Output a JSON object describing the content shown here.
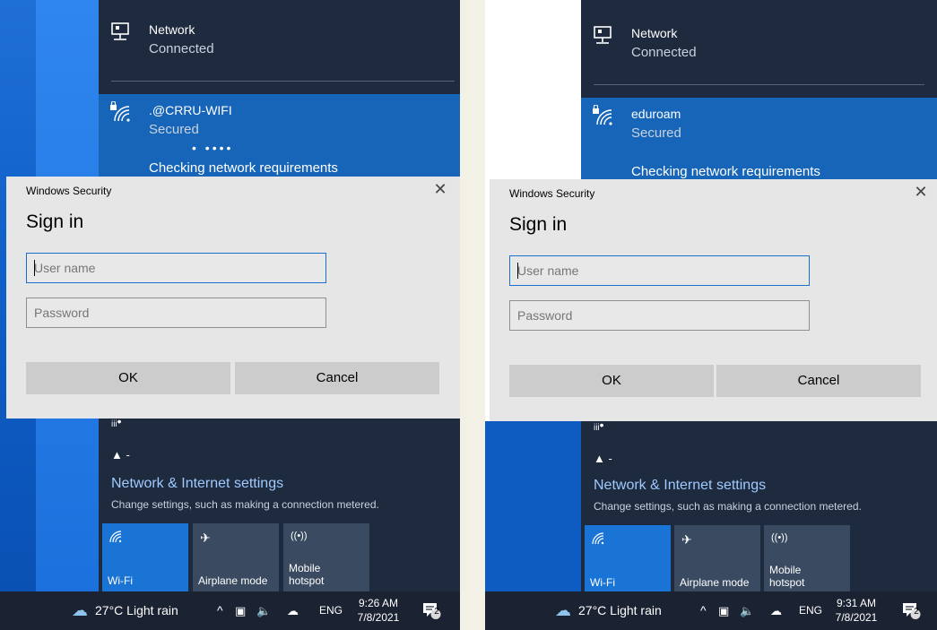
{
  "colors": {
    "flyout": "#1e2a3e",
    "selected": "#1665b8",
    "accent": "#1a74d6",
    "dialog": "#e6e6e6",
    "link": "#9fcaff"
  },
  "panels": [
    {
      "wired": {
        "name": "Network",
        "status": "Connected"
      },
      "wifi": {
        "name": ".@CRRU-WIFI",
        "status": "Secured",
        "progress": "• ••••",
        "message": "Checking network requirements"
      },
      "dialog": {
        "title": "Windows Security",
        "close": "✕",
        "heading": "Sign in",
        "username_placeholder": "User name",
        "password_placeholder": "Password",
        "ok": "OK",
        "cancel": "Cancel"
      },
      "settings": {
        "link": "Network & Internet settings",
        "description": "Change settings, such as making a connection metered."
      },
      "tiles": [
        {
          "label": "Wi-Fi",
          "icon": "wifi-icon"
        },
        {
          "label": "Airplane mode",
          "icon": "airplane-icon"
        },
        {
          "label": "Mobile hotspot",
          "icon": "hotspot-icon"
        }
      ],
      "taskbar": {
        "weather": "27°C  Light rain",
        "lang": "ENG",
        "time": "9:26 AM",
        "date": "7/8/2021",
        "notifications": "2"
      }
    },
    {
      "wired": {
        "name": "Network",
        "status": "Connected"
      },
      "wifi": {
        "name": "eduroam",
        "status": "Secured",
        "message": "Checking network requirements"
      },
      "dialog": {
        "title": "Windows Security",
        "close": "✕",
        "heading": "Sign in",
        "username_placeholder": "User name",
        "password_placeholder": "Password",
        "ok": "OK",
        "cancel": "Cancel"
      },
      "settings": {
        "link": "Network & Internet settings",
        "description": "Change settings, such as making a connection metered."
      },
      "tiles": [
        {
          "label": "Wi-Fi",
          "icon": "wifi-icon"
        },
        {
          "label": "Airplane mode",
          "icon": "airplane-icon"
        },
        {
          "label": "Mobile hotspot",
          "icon": "hotspot-icon"
        }
      ],
      "taskbar": {
        "weather": "27°C  Light rain",
        "lang": "ENG",
        "time": "9:31 AM",
        "date": "7/8/2021",
        "notifications": "2"
      }
    }
  ]
}
